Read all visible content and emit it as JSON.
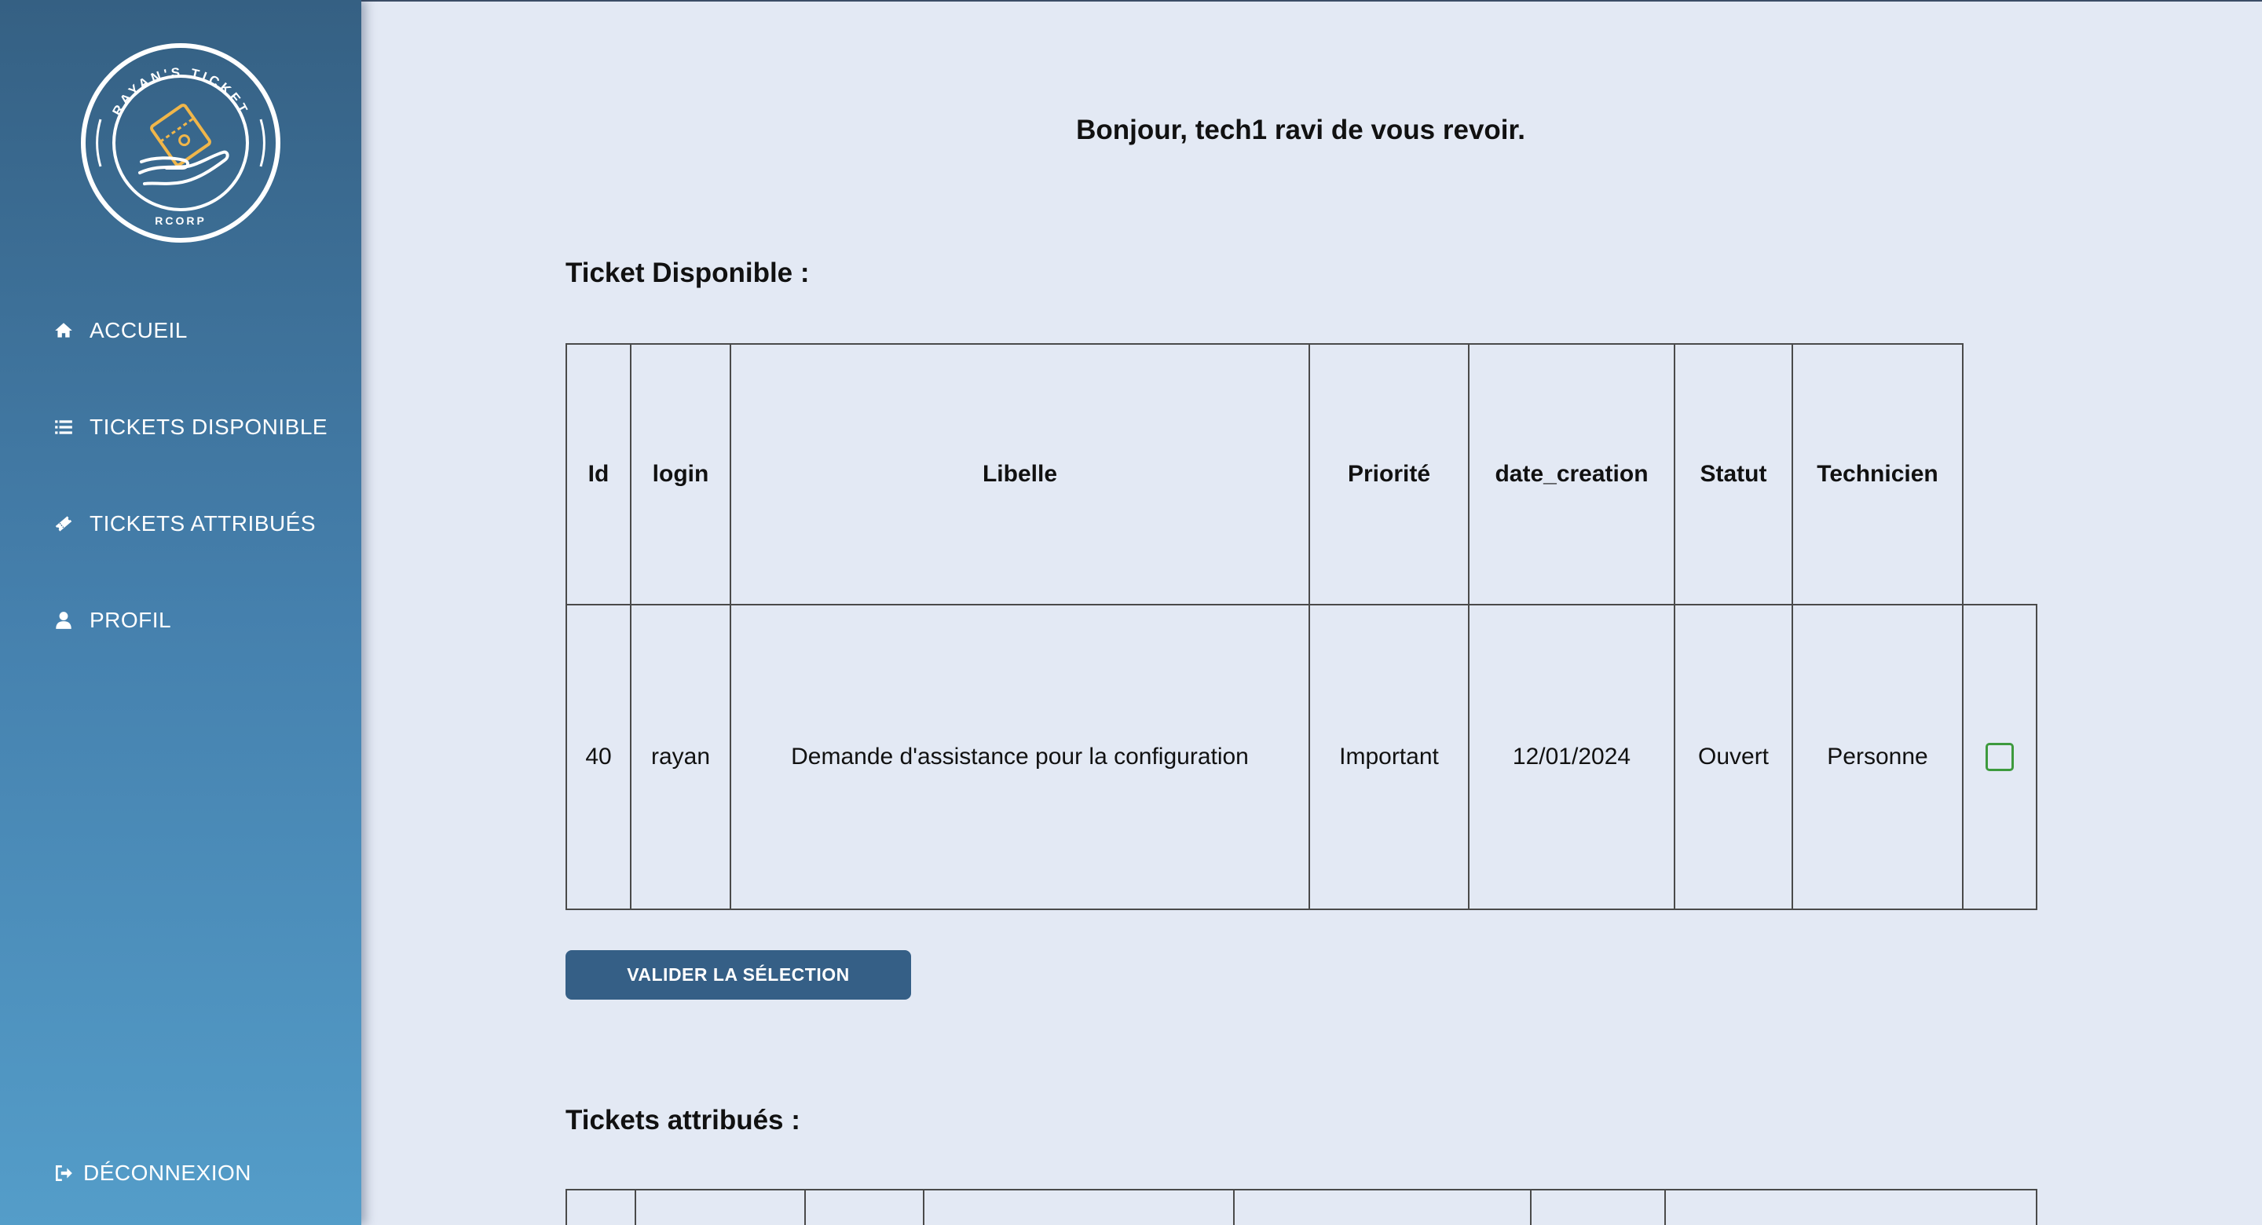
{
  "brand": {
    "ring_text": "RAYAN'S TICKET",
    "sub_text": "RCORP",
    "ring_color": "#ffffff",
    "ticket_color": "#f0b64a"
  },
  "sidebar": {
    "items": [
      {
        "label": "ACCUEIL",
        "icon": "home-icon"
      },
      {
        "label": "TICKETS DISPONIBLE",
        "icon": "list-icon"
      },
      {
        "label": "TICKETS ATTRIBUÉS",
        "icon": "ticket-icon"
      },
      {
        "label": "PROFIL",
        "icon": "user-icon"
      }
    ],
    "logout": {
      "label": "DÉCONNEXION",
      "icon": "sign-out-icon"
    }
  },
  "main": {
    "greeting": "Bonjour, tech1 ravi de vous revoir.",
    "available_title": "Ticket Disponible :",
    "available_table": {
      "headers": [
        "Id",
        "login",
        "Libelle",
        "Priorité",
        "date_creation",
        "Statut",
        "Technicien"
      ],
      "rows": [
        {
          "id": "40",
          "login": "rayan",
          "libelle": "Demande d'assistance pour la configuration",
          "priorite": "Important",
          "date_creation": "12/01/2024",
          "statut": "Ouvert",
          "technicien": "Personne",
          "selected": false
        }
      ]
    },
    "validate_button": "VALIDER LA SÉLECTION",
    "assigned_title": "Tickets attribués :"
  },
  "colors": {
    "background": "#e3e9f4",
    "sidebar_top": "#356083",
    "sidebar_bottom": "#549dc9",
    "button": "#355f86",
    "checkbox_border": "#3d9a3d"
  }
}
